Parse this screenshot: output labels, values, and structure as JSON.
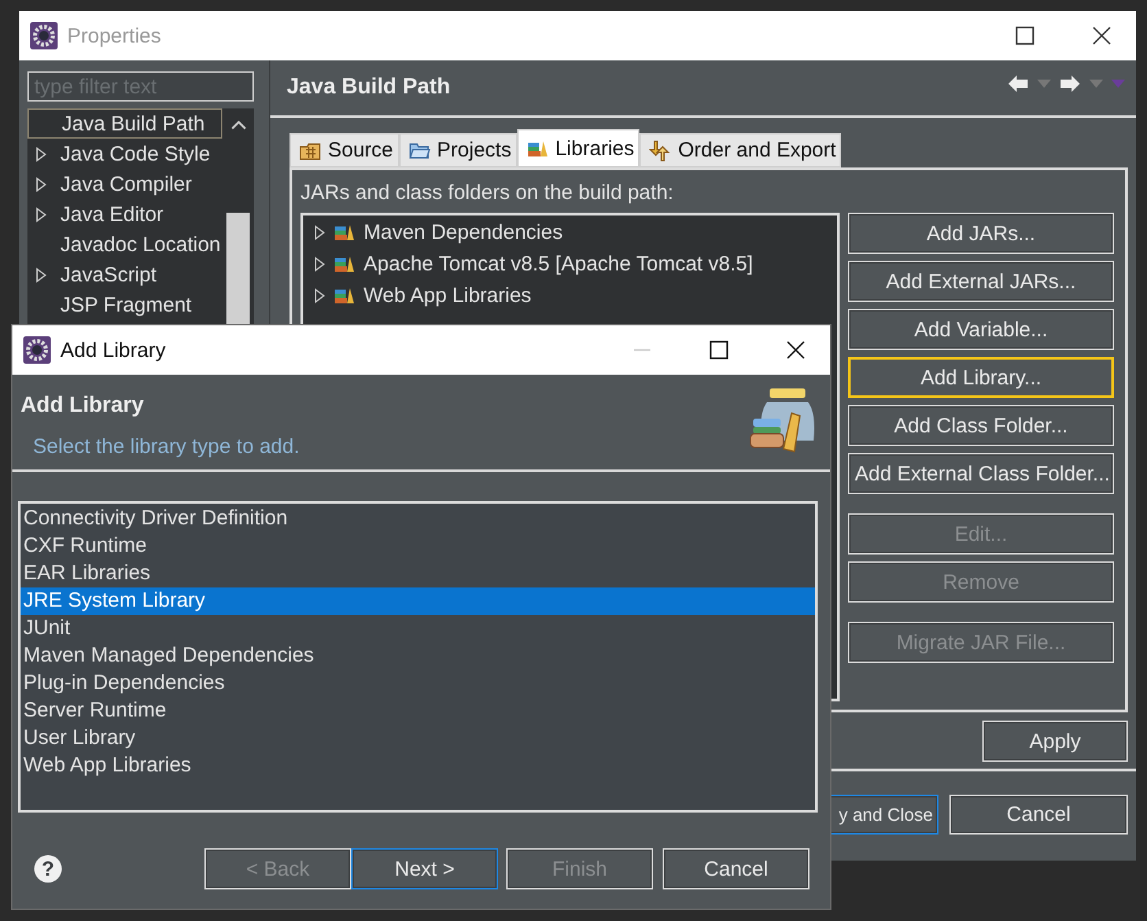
{
  "properties_window": {
    "title": "Properties",
    "filter": {
      "placeholder": "type filter text"
    },
    "tree": [
      {
        "label": "Java Build Path",
        "selected": true,
        "expandable": false
      },
      {
        "label": "Java Code Style",
        "selected": false,
        "expandable": true
      },
      {
        "label": "Java Compiler",
        "selected": false,
        "expandable": true
      },
      {
        "label": "Java Editor",
        "selected": false,
        "expandable": true
      },
      {
        "label": "Javadoc Location",
        "selected": false,
        "expandable": false
      },
      {
        "label": "JavaScript",
        "selected": false,
        "expandable": true
      },
      {
        "label": "JSP Fragment",
        "selected": false,
        "expandable": false
      }
    ],
    "page_title": "Java Build Path",
    "tabs": [
      {
        "label": "Source",
        "selected": false
      },
      {
        "label": "Projects",
        "selected": false
      },
      {
        "label": "Libraries",
        "selected": true
      },
      {
        "label": "Order and Export",
        "selected": false
      }
    ],
    "build_path_label": "JARs and class folders on the build path:",
    "entries": [
      {
        "label": "Maven Dependencies"
      },
      {
        "label": "Apache Tomcat v8.5 [Apache Tomcat v8.5]"
      },
      {
        "label": "Web App Libraries"
      }
    ],
    "side_button_groups": [
      [
        {
          "label": "Add JARs...",
          "disabled": false,
          "focused": false
        },
        {
          "label": "Add External JARs...",
          "disabled": false,
          "focused": false
        },
        {
          "label": "Add Variable...",
          "disabled": false,
          "focused": false
        },
        {
          "label": "Add Library...",
          "disabled": false,
          "focused": true
        },
        {
          "label": "Add Class Folder...",
          "disabled": false,
          "focused": false
        },
        {
          "label": "Add External Class Folder...",
          "disabled": false,
          "focused": false
        }
      ],
      [
        {
          "label": "Edit...",
          "disabled": true,
          "focused": false
        },
        {
          "label": "Remove",
          "disabled": true,
          "focused": false
        }
      ],
      [
        {
          "label": "Migrate JAR File...",
          "disabled": true,
          "focused": false
        }
      ]
    ],
    "apply_button": "Apply",
    "bottom_buttons": [
      {
        "label": "y and Close",
        "default": true
      },
      {
        "label": "Cancel",
        "default": false
      }
    ]
  },
  "add_library_dialog": {
    "title": "Add Library",
    "heading": "Add Library",
    "description": "Select the library type to add.",
    "library_types": [
      {
        "label": "Connectivity Driver Definition",
        "selected": false
      },
      {
        "label": "CXF Runtime",
        "selected": false
      },
      {
        "label": "EAR Libraries",
        "selected": false
      },
      {
        "label": "JRE System Library",
        "selected": true
      },
      {
        "label": "JUnit",
        "selected": false
      },
      {
        "label": "Maven Managed Dependencies",
        "selected": false
      },
      {
        "label": "Plug-in Dependencies",
        "selected": false
      },
      {
        "label": "Server Runtime",
        "selected": false
      },
      {
        "label": "User Library",
        "selected": false
      },
      {
        "label": "Web App Libraries",
        "selected": false
      }
    ],
    "help": "?",
    "buttons": [
      {
        "label": "< Back",
        "disabled": true,
        "default": false
      },
      {
        "label": "Next >",
        "disabled": false,
        "default": true
      },
      {
        "label": "Finish",
        "disabled": true,
        "default": false
      },
      {
        "label": "Cancel",
        "disabled": false,
        "default": false
      }
    ]
  }
}
